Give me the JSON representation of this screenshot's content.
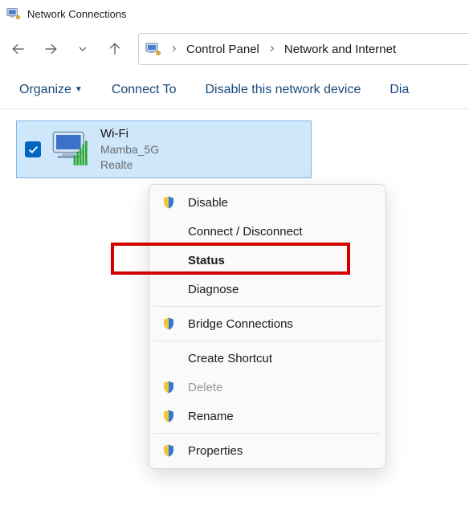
{
  "window": {
    "title": "Network Connections"
  },
  "breadcrumb": {
    "item1": "Control Panel",
    "item2": "Network and Internet"
  },
  "toolbar": {
    "organize": "Organize",
    "connect_to": "Connect To",
    "disable_device": "Disable this network device",
    "diagnose": "Dia"
  },
  "adapter": {
    "name": "Wi-Fi",
    "ssid": "Mamba_5G",
    "device": "Realte"
  },
  "context_menu": {
    "disable": "Disable",
    "connect_disconnect": "Connect / Disconnect",
    "status": "Status",
    "diagnose": "Diagnose",
    "bridge": "Bridge Connections",
    "create_shortcut": "Create Shortcut",
    "delete": "Delete",
    "rename": "Rename",
    "properties": "Properties"
  }
}
